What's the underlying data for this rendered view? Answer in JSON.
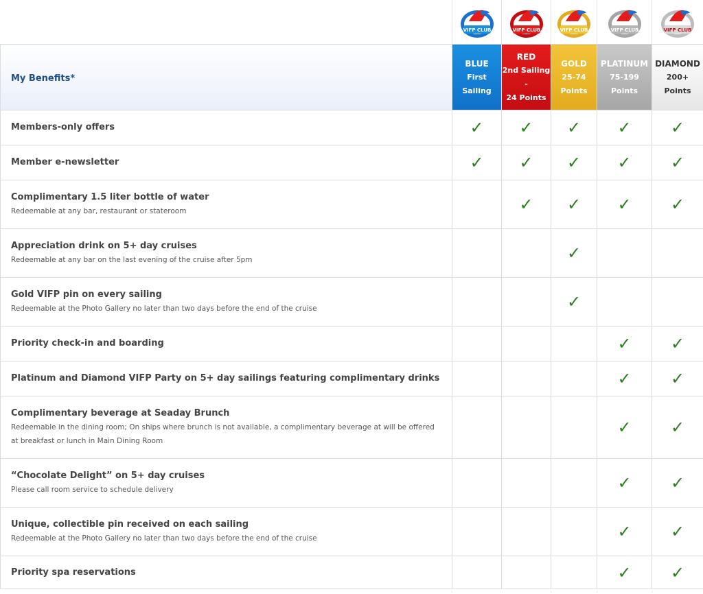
{
  "logos": [
    {
      "tier": "blue",
      "badge_text": "VIFP CLUB",
      "colors": {
        "stripe": "#1a6fd1",
        "fill": "#1a8fe0"
      }
    },
    {
      "tier": "red",
      "badge_text": "VIFP CLUB",
      "colors": {
        "stripe": "#c40d12",
        "fill": "#e31c1c"
      }
    },
    {
      "tier": "gold",
      "badge_text": "VIFP CLUB",
      "colors": {
        "stripe": "#e3ab1f",
        "fill": "#f2c438"
      }
    },
    {
      "tier": "platinum",
      "badge_text": "VIFP CLUB",
      "colors": {
        "stripe": "#a5a5a5",
        "fill": "#c9c9c9"
      }
    },
    {
      "tier": "diamond",
      "badge_text": "VIFP CLUB",
      "colors": {
        "stripe": "#bdbdbd",
        "fill": "#e6e6e6"
      }
    }
  ],
  "header": {
    "benefits_label": "My Benefits*",
    "tiers": [
      {
        "name": "BLUE",
        "lines": [
          "First",
          "Sailing"
        ]
      },
      {
        "name": "RED",
        "lines": [
          "2nd Sailing",
          "-",
          "24 Points"
        ]
      },
      {
        "name": "GOLD",
        "lines": [
          "25-74",
          "Points"
        ]
      },
      {
        "name": "PLATINUM",
        "lines": [
          "75-199",
          "Points"
        ]
      },
      {
        "name": "DIAMOND",
        "lines": [
          "200+ Points"
        ]
      }
    ]
  },
  "check_glyph": "✓",
  "colors": {
    "check": "#2e7d22",
    "header_text": "#1f4e8c"
  },
  "rows": [
    {
      "title": "Members-only offers",
      "subtitle": "",
      "checks": [
        true,
        true,
        true,
        true,
        true
      ]
    },
    {
      "title": "Member e-newsletter",
      "subtitle": "",
      "checks": [
        true,
        true,
        true,
        true,
        true
      ]
    },
    {
      "title": "Complimentary 1.5 liter bottle of water",
      "subtitle": "Redeemable at any bar, restaurant or stateroom",
      "checks": [
        false,
        true,
        true,
        true,
        true
      ]
    },
    {
      "title": "Appreciation drink on 5+ day cruises",
      "subtitle": "Redeemable at any bar on the last evening of the cruise after 5pm",
      "checks": [
        false,
        false,
        true,
        false,
        false
      ]
    },
    {
      "title": "Gold VIFP pin on every sailing",
      "subtitle": "Redeemable at the Photo Gallery no later than two days before the end of the cruise",
      "checks": [
        false,
        false,
        true,
        false,
        false
      ]
    },
    {
      "title": "Priority check-in and boarding",
      "subtitle": "",
      "checks": [
        false,
        false,
        false,
        true,
        true
      ]
    },
    {
      "title": "Platinum and Diamond VIFP Party on 5+ day sailings featuring complimentary drinks",
      "subtitle": "",
      "checks": [
        false,
        false,
        false,
        true,
        true
      ]
    },
    {
      "title": "Complimentary beverage at Seaday Brunch",
      "subtitle": "Redeemable in the dining room; On ships where brunch is not available, a complimentary beverage at will be offered at breakfast or lunch in Main Dining Room",
      "checks": [
        false,
        false,
        false,
        true,
        true
      ]
    },
    {
      "title": "“Chocolate Delight” on 5+ day cruises",
      "subtitle": "Please call room service to schedule delivery",
      "checks": [
        false,
        false,
        false,
        true,
        true
      ]
    },
    {
      "title": "Unique, collectible pin received on each sailing",
      "subtitle": "Redeemable at the Photo Gallery no later than two days before the end of the cruise",
      "checks": [
        false,
        false,
        false,
        true,
        true
      ]
    },
    {
      "title": "Priority spa reservations",
      "subtitle": "",
      "checks": [
        false,
        false,
        false,
        true,
        true
      ]
    }
  ]
}
